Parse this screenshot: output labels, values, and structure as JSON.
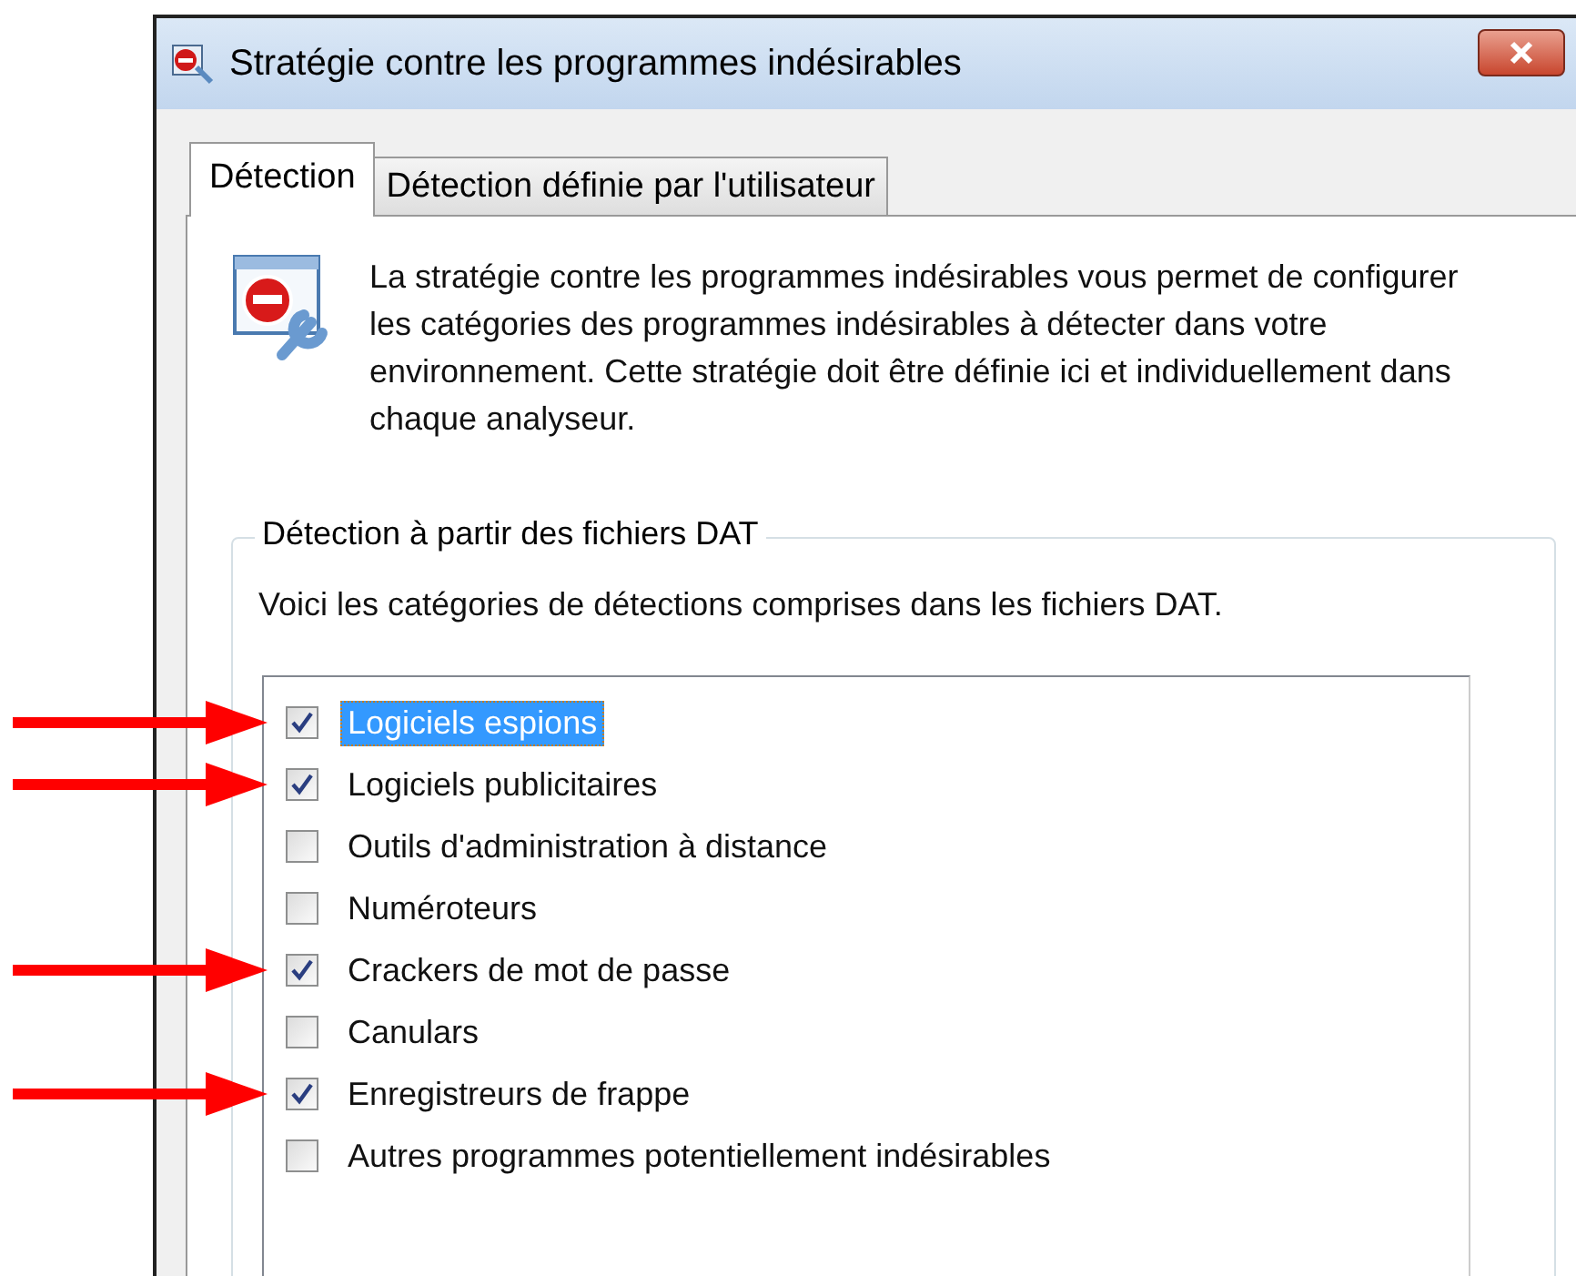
{
  "window": {
    "title": "Stratégie contre les programmes indésirables"
  },
  "tabs": [
    {
      "label": "Détection",
      "selected": true
    },
    {
      "label": "Détection définie par l'utilisateur",
      "selected": false
    }
  ],
  "description": "La stratégie contre les programmes indésirables vous permet de configurer les catégories des programmes indésirables à détecter dans votre environnement. Cette stratégie doit être définie ici et individuellement dans chaque analyseur.",
  "group": {
    "title": "Détection à partir des fichiers DAT",
    "caption": "Voici les catégories de détections comprises dans les fichiers DAT.",
    "items": [
      {
        "label": "Logiciels espions",
        "checked": true,
        "selected": true,
        "arrowed": true
      },
      {
        "label": "Logiciels publicitaires",
        "checked": true,
        "selected": false,
        "arrowed": true
      },
      {
        "label": "Outils d'administration à distance",
        "checked": false,
        "selected": false,
        "arrowed": false
      },
      {
        "label": "Numéroteurs",
        "checked": false,
        "selected": false,
        "arrowed": false
      },
      {
        "label": "Crackers de mot de passe",
        "checked": true,
        "selected": false,
        "arrowed": true
      },
      {
        "label": "Canulars",
        "checked": false,
        "selected": false,
        "arrowed": false
      },
      {
        "label": "Enregistreurs de frappe",
        "checked": true,
        "selected": false,
        "arrowed": true
      },
      {
        "label": "Autres programmes potentiellement indésirables",
        "checked": false,
        "selected": false,
        "arrowed": false
      }
    ]
  }
}
